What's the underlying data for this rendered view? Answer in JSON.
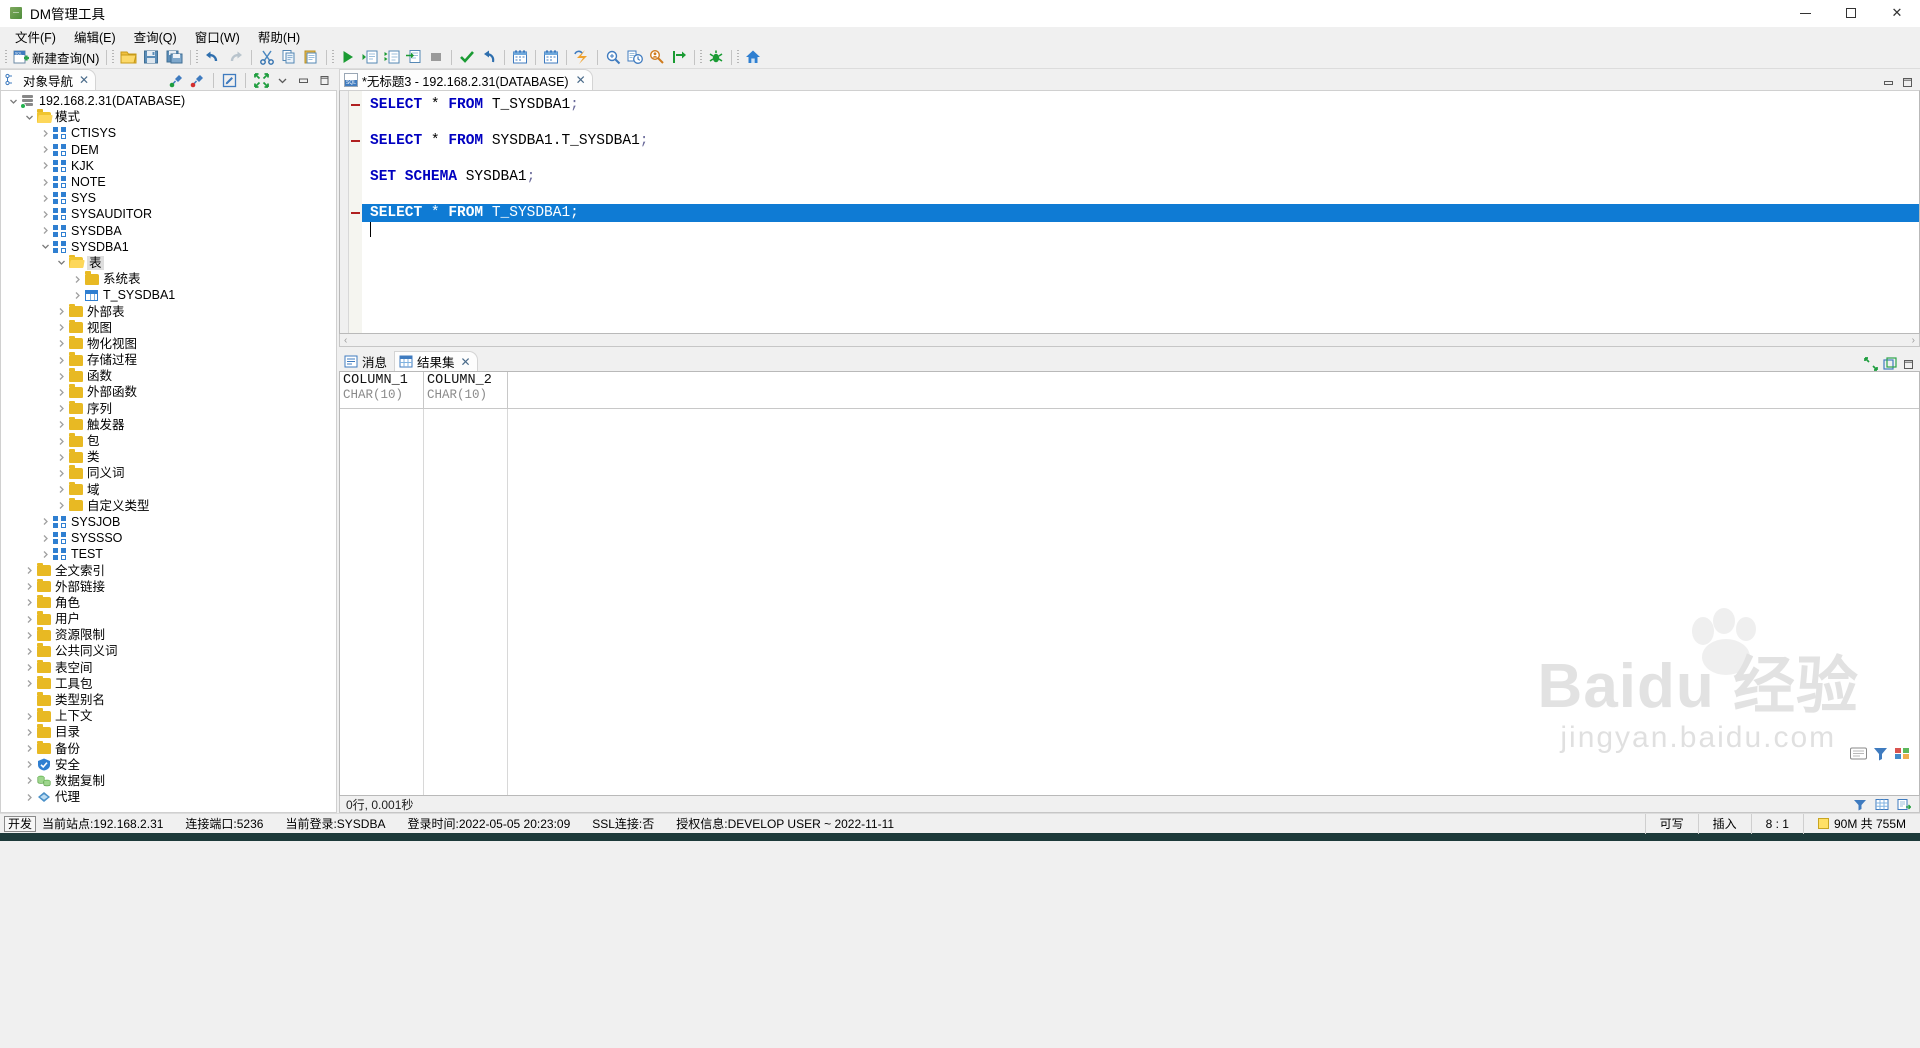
{
  "window": {
    "title": "DM管理工具",
    "icon": "dm-app-icon",
    "minimize": "─",
    "maximize": "□",
    "close": "✕"
  },
  "menubar": {
    "items": [
      {
        "name": "file",
        "text": "文件(F)",
        "pre": "文件(",
        "key": "F",
        "post": ")"
      },
      {
        "name": "edit",
        "text": "编辑(E)",
        "pre": "编辑(",
        "key": "E",
        "post": ")"
      },
      {
        "name": "query",
        "text": "查询(Q)",
        "pre": "查询(",
        "key": "Q",
        "post": ")"
      },
      {
        "name": "window",
        "text": "窗口(W)",
        "pre": "窗口(",
        "key": "W",
        "post": ")"
      },
      {
        "name": "help",
        "text": "帮助(H)",
        "pre": "帮助(",
        "key": "H",
        "post": ")"
      }
    ]
  },
  "toolbar": {
    "new_query_label": "新建查询(N)",
    "buttons": [
      {
        "name": "new-query-icon",
        "title": "新建查询"
      },
      {
        "name": "open-folder-icon",
        "title": "打开"
      },
      {
        "name": "save-icon",
        "title": "保存"
      },
      {
        "name": "save-as-icon",
        "title": "另存为"
      },
      {
        "name": "undo-icon",
        "title": "撤销"
      },
      {
        "name": "redo-icon",
        "title": "重做"
      },
      {
        "name": "cut-icon",
        "title": "剪切"
      },
      {
        "name": "copy-icon",
        "title": "复制"
      },
      {
        "name": "paste-icon",
        "title": "粘贴"
      },
      {
        "name": "execute-icon",
        "title": "执行"
      },
      {
        "name": "execute-step-icon",
        "title": "单步执行"
      },
      {
        "name": "execute-script-icon",
        "title": "执行脚本"
      },
      {
        "name": "export-icon",
        "title": "导出"
      },
      {
        "name": "stop-icon",
        "title": "停止"
      },
      {
        "name": "commit-icon",
        "title": "提交"
      },
      {
        "name": "rollback-icon",
        "title": "回滚"
      },
      {
        "name": "calendar-icon",
        "title": "作业"
      },
      {
        "name": "calendar2-icon",
        "title": "代理"
      },
      {
        "name": "lightning-icon",
        "title": "快捷"
      },
      {
        "name": "zoom-search-icon",
        "title": "查找"
      },
      {
        "name": "history-icon",
        "title": "历史"
      },
      {
        "name": "find-user-icon",
        "title": "查找用户"
      },
      {
        "name": "goto-icon",
        "title": "跳转"
      },
      {
        "name": "debug-icon",
        "title": "调试"
      },
      {
        "name": "home-icon",
        "title": "主页"
      }
    ]
  },
  "nav_panel": {
    "tab_label": "对象导航",
    "tab_icon": "object-nav-icon",
    "tab_close": "✕",
    "tools": [
      {
        "name": "connect-icon",
        "title": "连接"
      },
      {
        "name": "disconnect-icon",
        "title": "断开"
      },
      {
        "name": "edit-object-icon",
        "title": "编辑"
      },
      {
        "name": "collapse-all-icon",
        "title": "全部折叠"
      },
      {
        "name": "minimize-panel-icon",
        "title": "最小化"
      },
      {
        "name": "maximize-panel-icon",
        "title": "最大化"
      }
    ],
    "tree": [
      {
        "label": "192.168.2.31(DATABASE)",
        "indent": 0,
        "icon": "database-icon",
        "arrow": "expanded"
      },
      {
        "label": "模式",
        "indent": 1,
        "icon": "folder-open-icon",
        "arrow": "expanded"
      },
      {
        "label": "CTISYS",
        "indent": 2,
        "icon": "schema-icon",
        "arrow": "collapsed"
      },
      {
        "label": "DEM",
        "indent": 2,
        "icon": "schema-icon",
        "arrow": "collapsed"
      },
      {
        "label": "KJK",
        "indent": 2,
        "icon": "schema-icon",
        "arrow": "collapsed"
      },
      {
        "label": "NOTE",
        "indent": 2,
        "icon": "schema-icon",
        "arrow": "collapsed"
      },
      {
        "label": "SYS",
        "indent": 2,
        "icon": "schema-icon",
        "arrow": "collapsed"
      },
      {
        "label": "SYSAUDITOR",
        "indent": 2,
        "icon": "schema-icon",
        "arrow": "collapsed"
      },
      {
        "label": "SYSDBA",
        "indent": 2,
        "icon": "schema-icon",
        "arrow": "collapsed"
      },
      {
        "label": "SYSDBA1",
        "indent": 2,
        "icon": "schema-icon",
        "arrow": "expanded"
      },
      {
        "label": "表",
        "indent": 3,
        "icon": "folder-open-icon",
        "arrow": "expanded",
        "selected": true
      },
      {
        "label": "系统表",
        "indent": 4,
        "icon": "folder-icon",
        "arrow": "collapsed"
      },
      {
        "label": "T_SYSDBA1",
        "indent": 4,
        "icon": "table-icon",
        "arrow": "collapsed"
      },
      {
        "label": "外部表",
        "indent": 3,
        "icon": "folder-icon",
        "arrow": "collapsed"
      },
      {
        "label": "视图",
        "indent": 3,
        "icon": "folder-icon",
        "arrow": "collapsed"
      },
      {
        "label": "物化视图",
        "indent": 3,
        "icon": "folder-icon",
        "arrow": "collapsed"
      },
      {
        "label": "存储过程",
        "indent": 3,
        "icon": "folder-icon",
        "arrow": "collapsed"
      },
      {
        "label": "函数",
        "indent": 3,
        "icon": "folder-icon",
        "arrow": "collapsed"
      },
      {
        "label": "外部函数",
        "indent": 3,
        "icon": "folder-icon",
        "arrow": "collapsed"
      },
      {
        "label": "序列",
        "indent": 3,
        "icon": "folder-icon",
        "arrow": "collapsed"
      },
      {
        "label": "触发器",
        "indent": 3,
        "icon": "folder-icon",
        "arrow": "collapsed"
      },
      {
        "label": "包",
        "indent": 3,
        "icon": "folder-icon",
        "arrow": "collapsed"
      },
      {
        "label": "类",
        "indent": 3,
        "icon": "folder-icon",
        "arrow": "collapsed"
      },
      {
        "label": "同义词",
        "indent": 3,
        "icon": "folder-icon",
        "arrow": "collapsed"
      },
      {
        "label": "域",
        "indent": 3,
        "icon": "folder-icon",
        "arrow": "collapsed"
      },
      {
        "label": "自定义类型",
        "indent": 3,
        "icon": "folder-icon",
        "arrow": "collapsed"
      },
      {
        "label": "SYSJOB",
        "indent": 2,
        "icon": "schema-icon",
        "arrow": "collapsed"
      },
      {
        "label": "SYSSSO",
        "indent": 2,
        "icon": "schema-icon",
        "arrow": "collapsed"
      },
      {
        "label": "TEST",
        "indent": 2,
        "icon": "schema-icon",
        "arrow": "collapsed"
      },
      {
        "label": "全文索引",
        "indent": 1,
        "icon": "folder-icon",
        "arrow": "collapsed"
      },
      {
        "label": "外部链接",
        "indent": 1,
        "icon": "folder-icon",
        "arrow": "collapsed"
      },
      {
        "label": "角色",
        "indent": 1,
        "icon": "folder-icon",
        "arrow": "collapsed"
      },
      {
        "label": "用户",
        "indent": 1,
        "icon": "folder-icon",
        "arrow": "collapsed"
      },
      {
        "label": "资源限制",
        "indent": 1,
        "icon": "folder-icon",
        "arrow": "collapsed"
      },
      {
        "label": "公共同义词",
        "indent": 1,
        "icon": "folder-icon",
        "arrow": "collapsed"
      },
      {
        "label": "表空间",
        "indent": 1,
        "icon": "folder-icon",
        "arrow": "collapsed"
      },
      {
        "label": "工具包",
        "indent": 1,
        "icon": "folder-icon",
        "arrow": "collapsed"
      },
      {
        "label": "类型别名",
        "indent": 1,
        "icon": "folder-icon",
        "arrow": "none"
      },
      {
        "label": "上下文",
        "indent": 1,
        "icon": "folder-icon",
        "arrow": "collapsed"
      },
      {
        "label": "目录",
        "indent": 1,
        "icon": "folder-icon",
        "arrow": "collapsed"
      },
      {
        "label": "备份",
        "indent": 1,
        "icon": "folder-icon",
        "arrow": "collapsed"
      },
      {
        "label": "安全",
        "indent": 1,
        "icon": "shield-icon",
        "arrow": "collapsed"
      },
      {
        "label": "数据复制",
        "indent": 1,
        "icon": "replication-icon",
        "arrow": "collapsed"
      },
      {
        "label": "代理",
        "indent": 1,
        "icon": "agent-icon",
        "arrow": "collapsed"
      }
    ]
  },
  "editor": {
    "tab_label": "*无标题3 - 192.168.2.31(DATABASE)",
    "tab_icon": "sql-file-icon",
    "tab_close": "✕",
    "tools": [
      {
        "name": "minimize-editor-icon"
      },
      {
        "name": "maximize-editor-icon"
      }
    ],
    "lines": [
      {
        "n": 1,
        "mark": true,
        "tokens": [
          {
            "t": "SELECT",
            "c": "kw"
          },
          {
            "t": " * ",
            "c": "pl"
          },
          {
            "t": "FROM",
            "c": "kw"
          },
          {
            "t": " T_SYSDBA1",
            "c": "pl"
          },
          {
            "t": ";",
            "c": "semi"
          }
        ]
      },
      {
        "n": 2,
        "mark": false,
        "tokens": []
      },
      {
        "n": 3,
        "mark": true,
        "tokens": [
          {
            "t": "SELECT",
            "c": "kw"
          },
          {
            "t": " * ",
            "c": "pl"
          },
          {
            "t": "FROM",
            "c": "kw"
          },
          {
            "t": " SYSDBA1.T_SYSDBA1",
            "c": "pl"
          },
          {
            "t": ";",
            "c": "semi"
          }
        ]
      },
      {
        "n": 4,
        "mark": false,
        "tokens": []
      },
      {
        "n": 5,
        "mark": false,
        "tokens": [
          {
            "t": "SET SCHEMA",
            "c": "kw"
          },
          {
            "t": " SYSDBA1",
            "c": "pl"
          },
          {
            "t": ";",
            "c": "semi"
          }
        ]
      },
      {
        "n": 6,
        "mark": false,
        "tokens": []
      },
      {
        "n": 7,
        "mark": true,
        "highlight": true,
        "tokens": [
          {
            "t": "SELECT",
            "c": "kw"
          },
          {
            "t": " * ",
            "c": "pl"
          },
          {
            "t": "FROM",
            "c": "kw"
          },
          {
            "t": " T_SYSDBA1;",
            "c": "pl"
          }
        ]
      }
    ],
    "scroll_left": "‹",
    "scroll_right": "›"
  },
  "results": {
    "tabs": [
      {
        "label": "消息",
        "icon": "message-icon",
        "active": false
      },
      {
        "label": "结果集",
        "icon": "resultset-icon",
        "active": true,
        "close": "✕"
      }
    ],
    "tools": [
      {
        "name": "restore-results-icon"
      },
      {
        "name": "detach-results-icon"
      },
      {
        "name": "maximize-results-icon"
      }
    ],
    "columns": [
      {
        "name": "COLUMN_1",
        "type": "CHAR(10)"
      },
      {
        "name": "COLUMN_2",
        "type": "CHAR(10)"
      }
    ],
    "rows": [],
    "footer_status": "0行, 0.001秒",
    "footer_tools": [
      {
        "name": "filter-icon"
      },
      {
        "name": "grid-view-icon"
      },
      {
        "name": "export-grid-icon"
      }
    ],
    "watermark": {
      "main": "Baidu 经验",
      "sub": "jingyan.baidu.com"
    }
  },
  "statusbar": {
    "badge": "开发",
    "items": [
      "当前站点:192.168.2.31",
      "连接端口:5236",
      "当前登录:SYSDBA",
      "登录时间:2022-05-05 20:23:09",
      "SSL连接:否",
      "授权信息:DEVELOP USER ~ 2022-11-11"
    ],
    "writable": "可写",
    "insert_mode": "插入",
    "caret_position": "8 : 1",
    "memory": "90M 共 755M"
  }
}
